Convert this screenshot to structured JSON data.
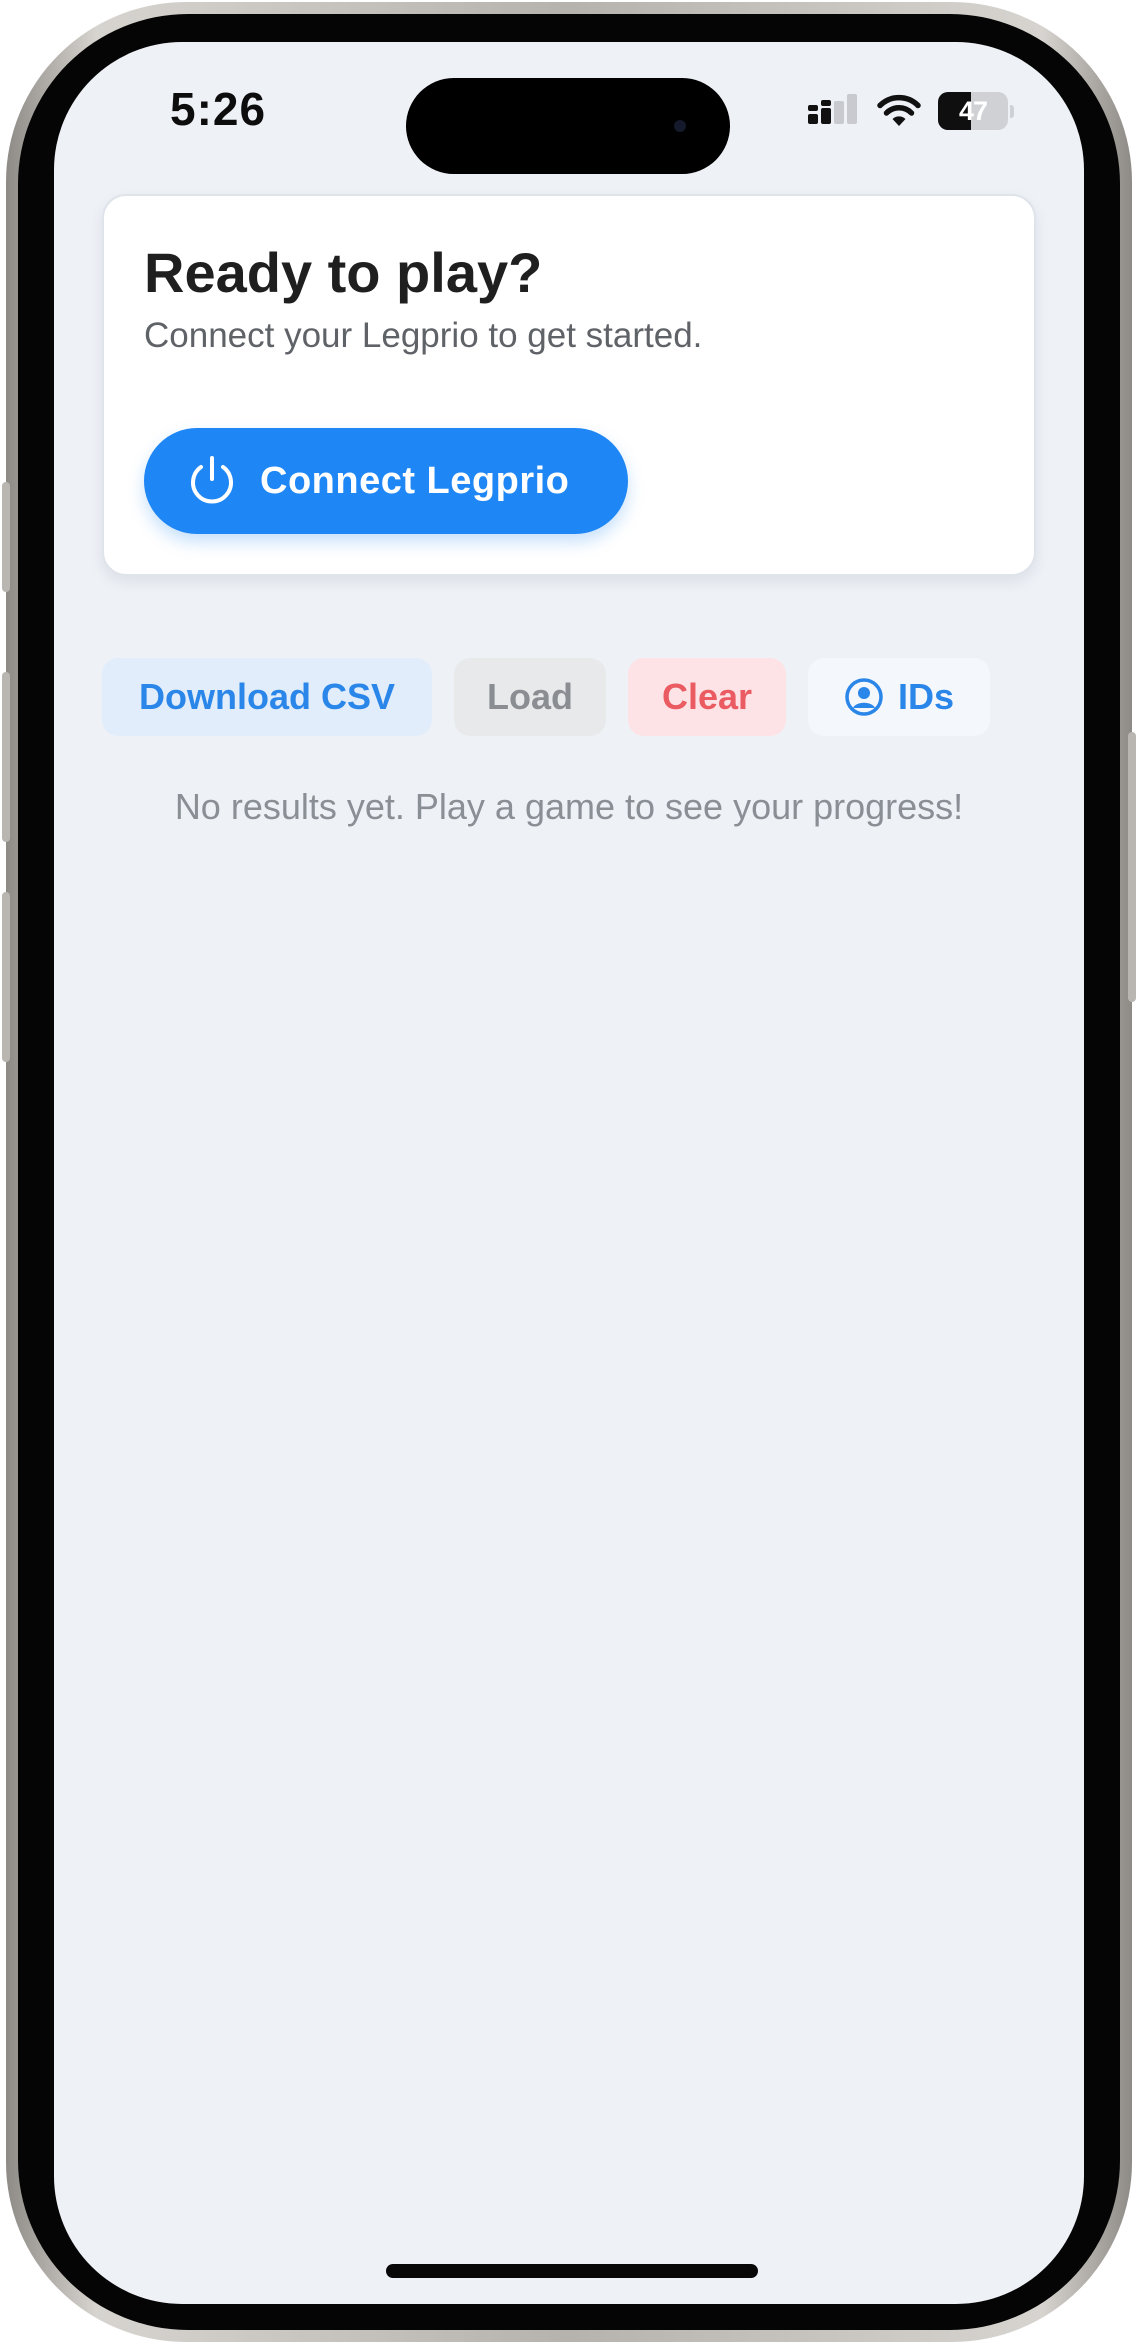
{
  "status_bar": {
    "time": "5:26",
    "battery_level": "47",
    "icons": [
      "cellular-signal-icon",
      "wifi-icon",
      "battery-icon"
    ]
  },
  "card": {
    "title": "Ready to play?",
    "subtitle": "Connect your Legprio to get started.",
    "connect_button": {
      "label": "Connect Legprio",
      "icon": "power-icon",
      "color": "#1f87f5"
    }
  },
  "actions": {
    "download_csv": "Download CSV",
    "load": "Load",
    "clear": "Clear",
    "ids": "IDs",
    "ids_icon": "user-circle-icon"
  },
  "results": {
    "empty_message": "No results yet. Play a game to see your progress!"
  },
  "colors": {
    "background": "#eef1f6",
    "accent": "#1f87f5",
    "danger": "#ea5b62"
  }
}
